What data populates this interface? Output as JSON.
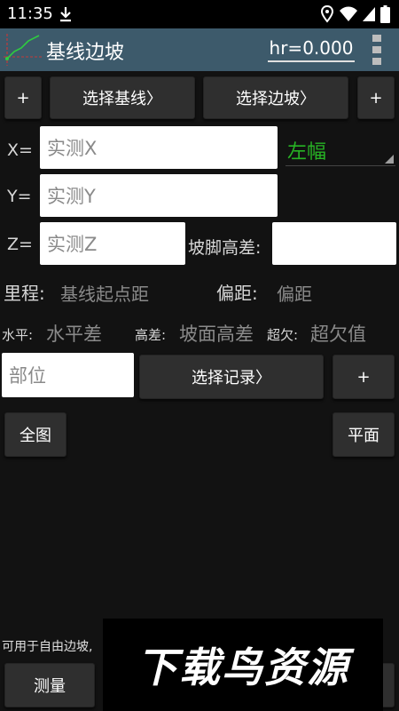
{
  "status": {
    "time": "11:35"
  },
  "app": {
    "title": "基线边坡",
    "hr": "hr=0.000"
  },
  "toolbar": {
    "add_left": "+",
    "select_baseline": "选择基线〉",
    "select_slope": "选择边坡〉",
    "add_right": "+"
  },
  "coords": {
    "x_label": "X=",
    "x_placeholder": "实测X",
    "y_label": "Y=",
    "y_placeholder": "实测Y",
    "z_label": "Z=",
    "z_placeholder": "实测Z",
    "side_value": "左幅",
    "toe_label": "坡脚高差:"
  },
  "results": {
    "mileage_label": "里程:",
    "mileage_value": "基线起点距",
    "offset_label": "偏距:",
    "offset_value": "偏距",
    "horizontal_label": "水平:",
    "horizontal_value": "水平差",
    "height_label": "高差:",
    "height_value": "坡面高差",
    "over_label": "超欠:",
    "over_value": "超欠值"
  },
  "record": {
    "part_placeholder": "部位",
    "select_record": "选择记录〉",
    "add": "+"
  },
  "view": {
    "full": "全图",
    "plane": "平面"
  },
  "footer": {
    "hint": "可用于自由边坡,",
    "measure": "测量",
    "watermark": "下载鸟资源"
  },
  "colors": {
    "appbar": "#3d5a6b",
    "accent_green": "#27b324",
    "background": "#121212"
  }
}
